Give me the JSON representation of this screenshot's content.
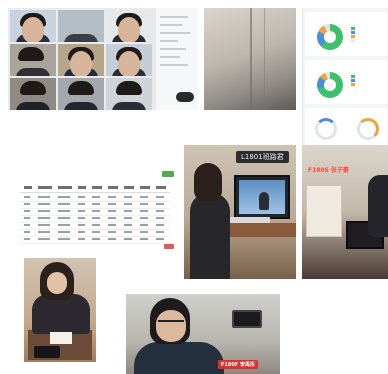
{
  "banner": {
    "text": "L1801班路君"
  },
  "captions": {
    "room": "F1805 张子豪",
    "boy": "F180F 李禹彤"
  }
}
